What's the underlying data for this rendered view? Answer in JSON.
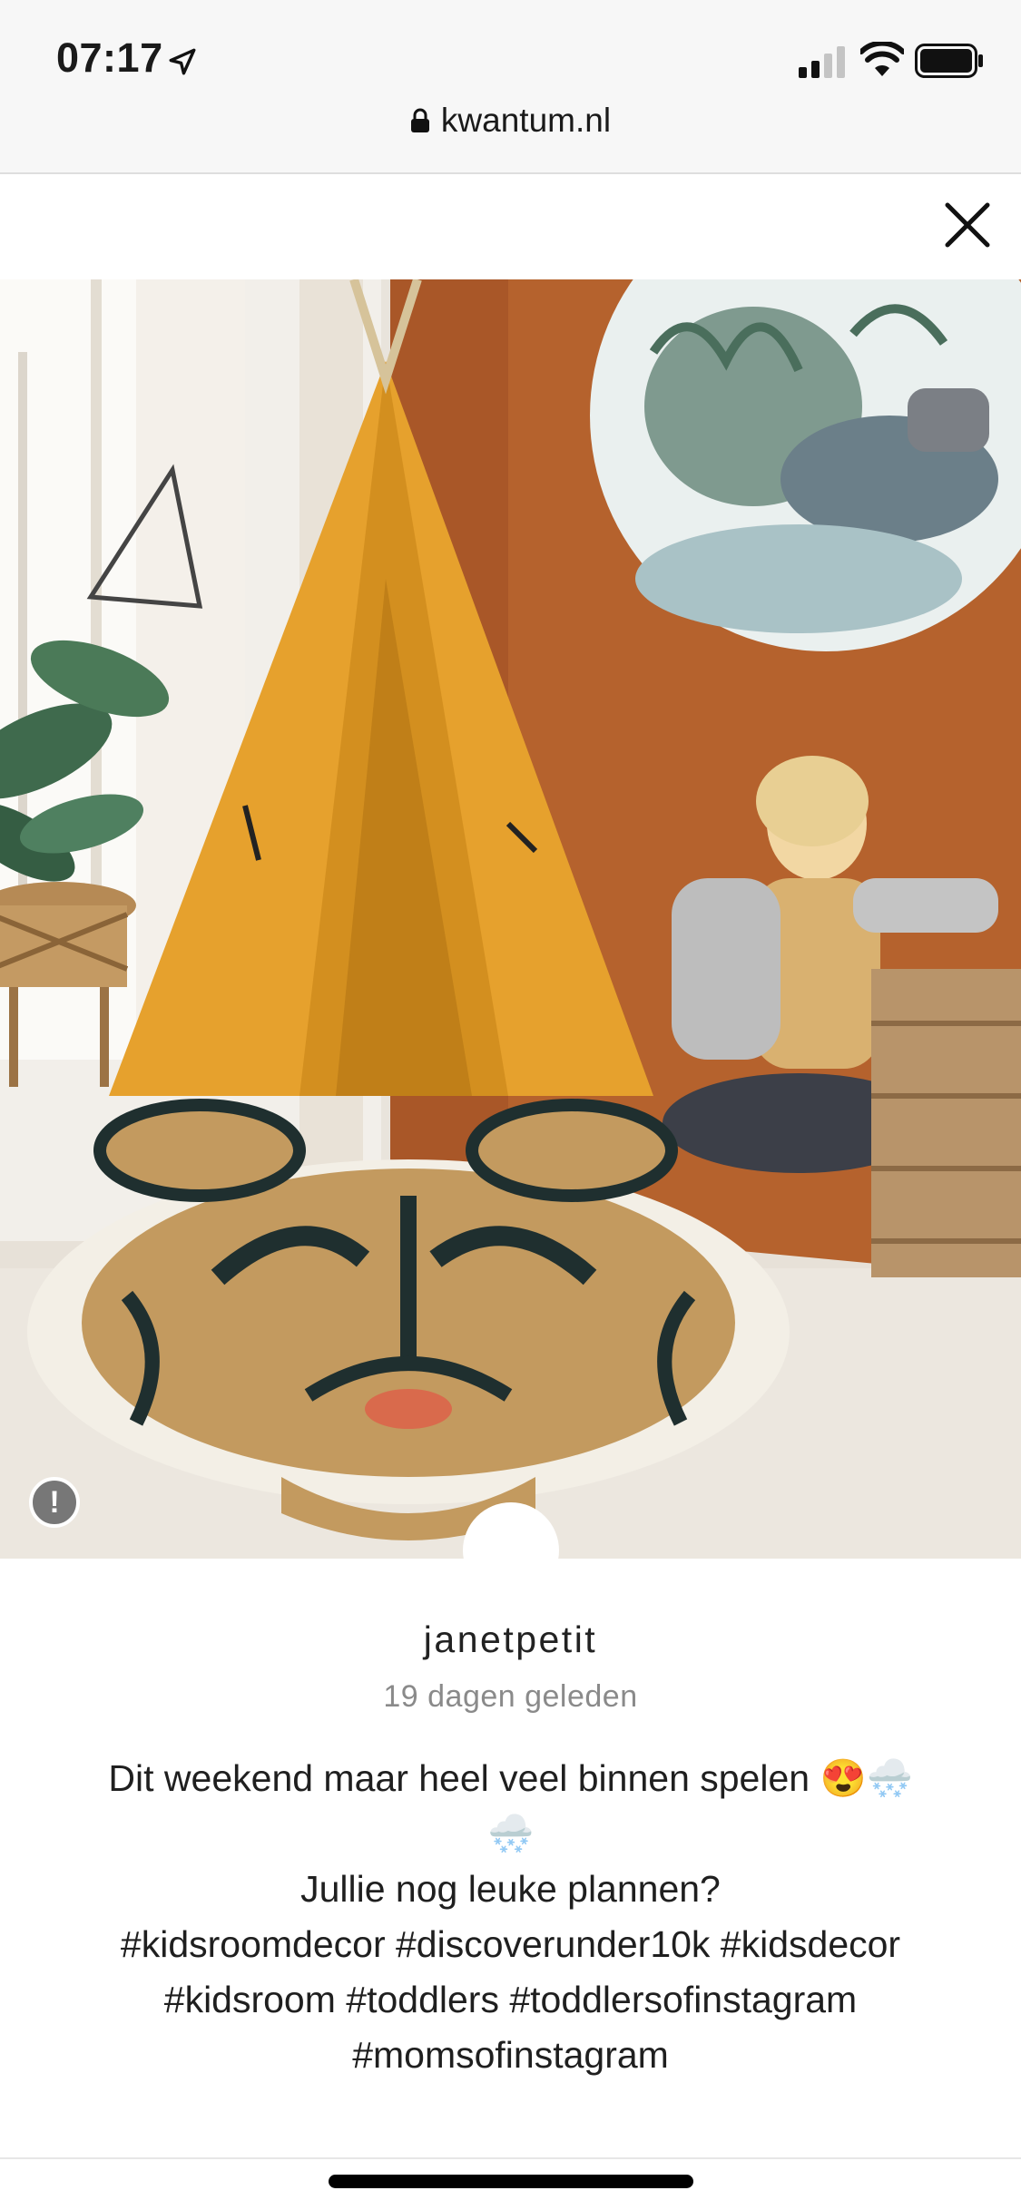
{
  "status_bar": {
    "time": "07:17",
    "icons": [
      "location-arrow-icon",
      "cellular-signal-icon",
      "wifi-icon",
      "battery-icon"
    ]
  },
  "browser": {
    "url": "kwantum.nl",
    "lock_icon": "lock-icon"
  },
  "modal": {
    "close_icon": "close-icon",
    "report_icon_glyph": "!"
  },
  "post": {
    "username": "janetpetit",
    "time_ago": "19 dagen geleden",
    "caption": "Dit weekend maar heel veel binnen spelen 😍🌨️\n🌨️\nJullie nog leuke plannen?\n#kidsroomdecor #discoverunder10k #kidsdecor\n#kidsroom #toddlers #toddlersofinstagram\n#momsofinstagram"
  },
  "colors": {
    "status_bg": "#f7f7f7",
    "wall": "#b5622d",
    "teepee": "#e6a12d",
    "meta_gray": "#8a8a8a"
  }
}
